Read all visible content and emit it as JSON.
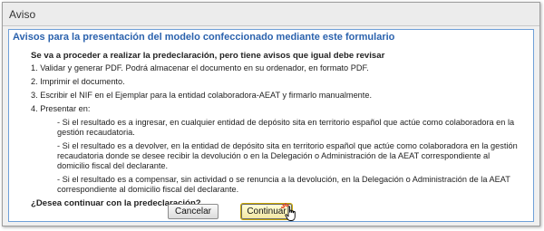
{
  "window": {
    "title": "Aviso"
  },
  "panel": {
    "title": "Avisos para la presentación del modelo confeccionado mediante este formulario"
  },
  "message": {
    "lead": "Se va a proceder a realizar la predeclaración, pero tiene avisos que igual debe revisar",
    "items": [
      "1. Validar y generar PDF. Podrá almacenar el documento en su ordenador, en formato PDF.",
      "2. Imprimir el documento.",
      "3. Escribir el NIF en el Ejemplar para la entidad colaboradora-AEAT y firmarlo manualmente.",
      "4. Presentar en:"
    ],
    "subitems": [
      "- Si el resultado es a ingresar, en cualquier entidad de depósito sita en territorio español que actúe como colaboradora en la gestión recaudatoria.",
      "- Si el resultado es a devolver, en la entidad de depósito sita en territorio español que actúe como colaboradora en la gestión recaudatoria donde se desee recibir la devolución o en la Delegación o Administración de la AEAT correspondiente al domicilio fiscal del declarante.",
      "- Si el resultado es a compensar, sin actividad o se renuncia a la devolución, en la Delegación o Administración de la AEAT correspondiente al domicilio fiscal del declarante."
    ],
    "question": "¿Desea continuar con la predeclaración?"
  },
  "buttons": {
    "cancel": "Cancelar",
    "continue": "Continuar"
  },
  "colors": {
    "panel_title": "#2b62ad",
    "panel_border": "#6fa0d8",
    "continue_bg": "#f7efb8"
  },
  "icons": {
    "cursor": "hand-pointer-icon",
    "click": "click-spark-icon"
  }
}
